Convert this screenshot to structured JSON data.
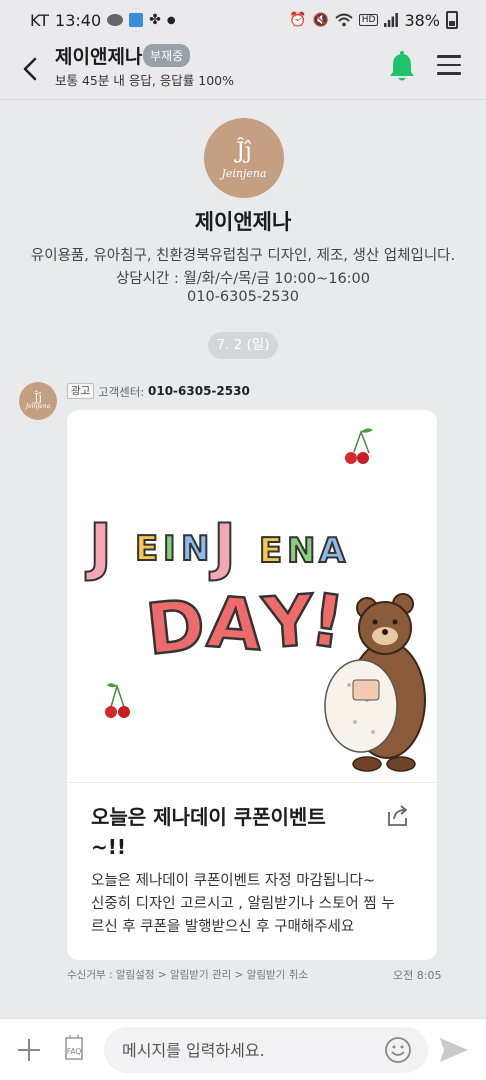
{
  "status_bar": {
    "carrier": "KT",
    "time": "13:40",
    "battery": "38%"
  },
  "header": {
    "title": "제이앤제나",
    "badge": "부재중",
    "subtitle": "보통 45분 내 응답, 응답률 100%"
  },
  "profile": {
    "logo_mark": "Ĵĵ",
    "logo_text": "Jeinjena",
    "name": "제이앤제나",
    "description": "유이용품, 유아침구, 친환경북유럽침구 디자인, 제조, 생산 업체입니다.",
    "hours": "상담시간 : 월/화/수/목/금 10:00~16:00",
    "phone": "010-6305-2530"
  },
  "date_divider": "7. 2 (일)",
  "message": {
    "ad_label": "광고",
    "cs_label": "고객센터:",
    "cs_phone": "010-6305-2530",
    "banner": {
      "word1": "JEINJENA",
      "word2": "DAY!"
    },
    "title_line1": "오늘은 제나데이 쿠폰이벤트",
    "title_line2": "~!!",
    "body_line1": "오늘은 제나데이 쿠폰이벤트 자정 마감됩니다~",
    "body_line2": "신중히 디자인 고르시고 , 알림받기나 스토어 찜 누",
    "body_line3": "르신 후 쿠폰을 발행받으신 후 구매해주세요",
    "footer": "수신거부 : 알림설정 > 알림받기 관리 > 알림받기 취소",
    "time": "오전 8:05"
  },
  "input": {
    "placeholder": "메시지를 입력하세요.",
    "faq_label": "FAQ"
  },
  "colors": {
    "background": "#e9eaec",
    "brand": "#c59f82",
    "bell_green": "#1fc36a",
    "date_chip": "#d4d6da"
  }
}
